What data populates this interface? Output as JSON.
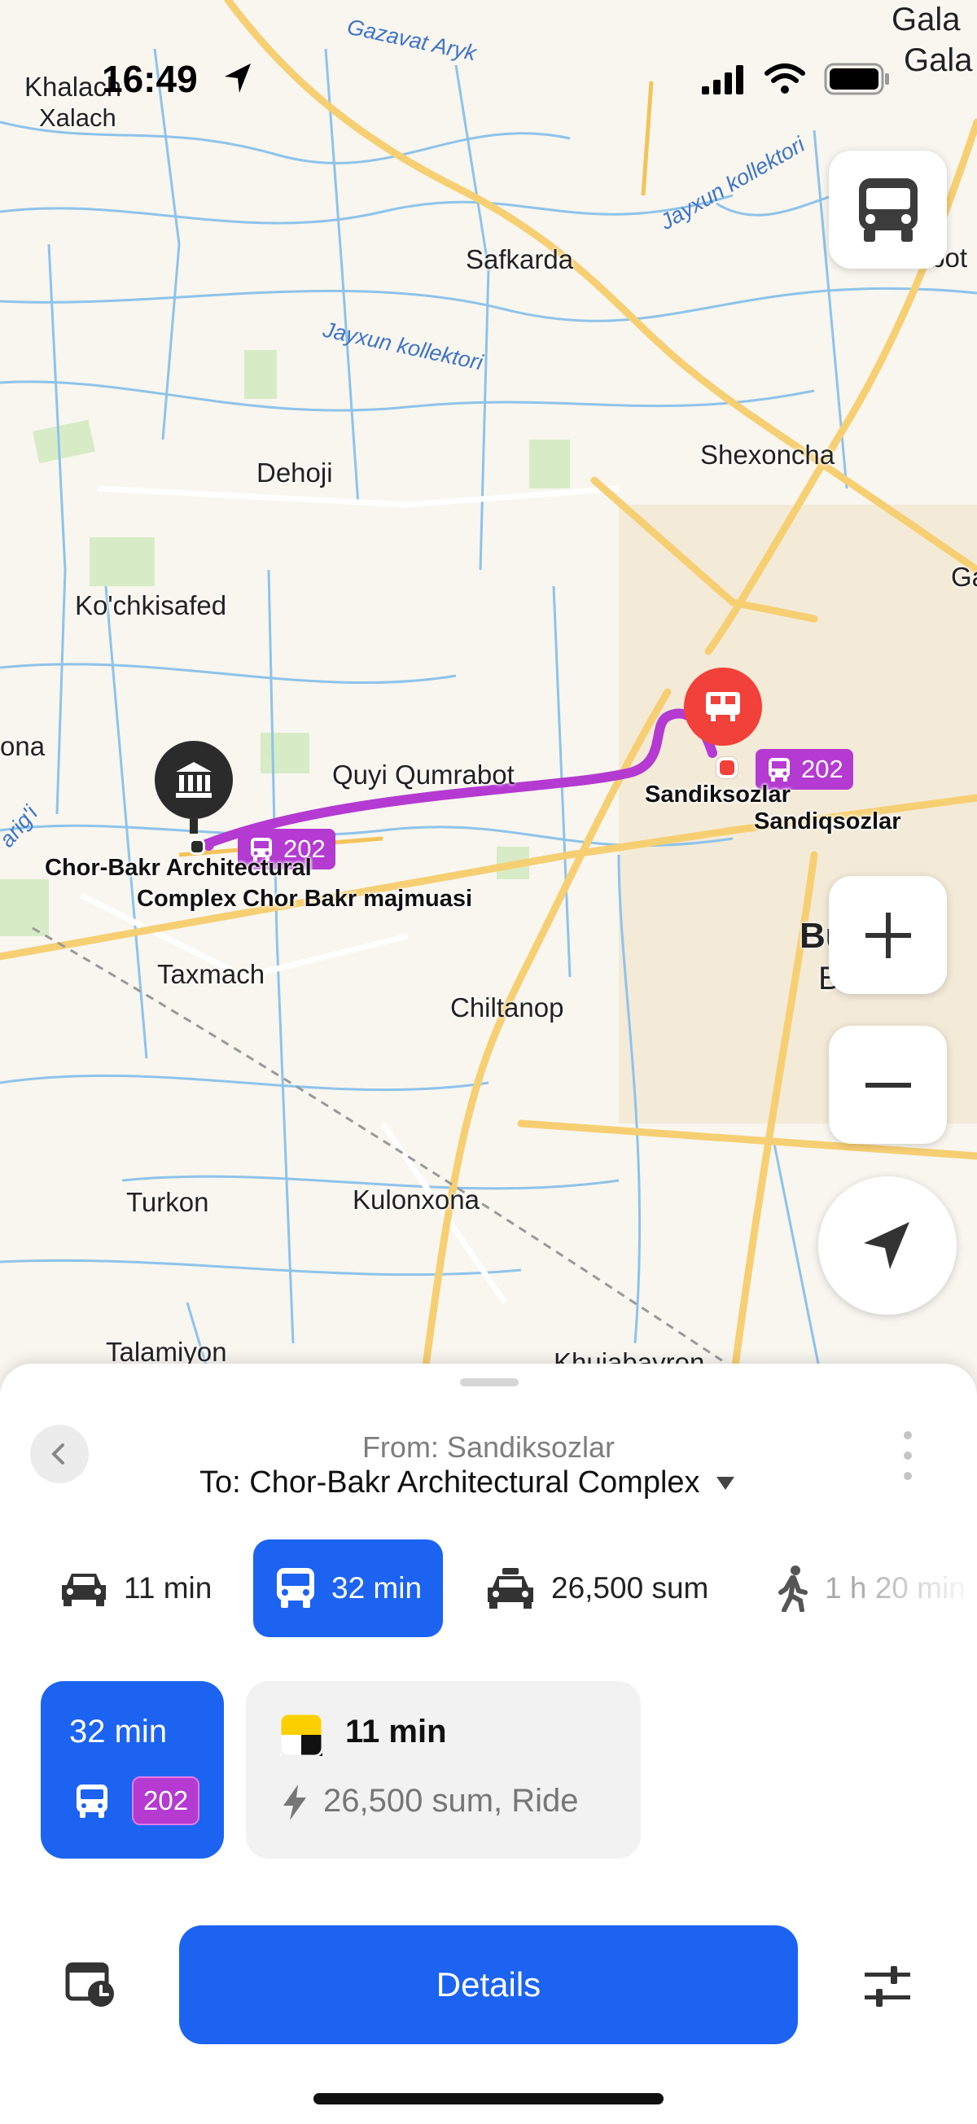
{
  "status_bar": {
    "time": "16:49"
  },
  "map": {
    "places": [
      {
        "id": "khalach",
        "text": "Khalach"
      },
      {
        "id": "xalach",
        "text": "Xalach"
      },
      {
        "id": "gala1",
        "text": "Gala"
      },
      {
        "id": "gala2",
        "text": "Gala"
      },
      {
        "id": "safkarda",
        "text": "Safkarda"
      },
      {
        "id": "rabot",
        "text": "Rabot"
      },
      {
        "id": "shexoncha",
        "text": "Shexoncha"
      },
      {
        "id": "dehoji",
        "text": "Dehoji"
      },
      {
        "id": "kochkisafed",
        "text": "Ko'chkisafed"
      },
      {
        "id": "quyi",
        "text": "Quyi Qumrabot"
      },
      {
        "id": "ona",
        "text": "ona"
      },
      {
        "id": "taxmach",
        "text": "Taxmach"
      },
      {
        "id": "chiltanop",
        "text": "Chiltanop"
      },
      {
        "id": "bukhara",
        "text": "Bukhara"
      },
      {
        "id": "buxoro",
        "text": "Buxoro"
      },
      {
        "id": "turkon",
        "text": "Turkon"
      },
      {
        "id": "kulonxona",
        "text": "Kulonxona"
      },
      {
        "id": "talamiyon",
        "text": "Talamiyon"
      },
      {
        "id": "khujabayron",
        "text": "Khujabayron"
      },
      {
        "id": "ga",
        "text": "Ga"
      }
    ],
    "waterways": [
      {
        "id": "gazavat",
        "text": "Gazavat Aryk"
      },
      {
        "id": "jayxun",
        "text": "Jayxun kollektori"
      },
      {
        "id": "jayxun2",
        "text": "Jayxun kollektori"
      },
      {
        "id": "arig",
        "text": "arig'i"
      }
    ],
    "pois": {
      "destination_1": "Chor-Bakr Architectural",
      "destination_2": "Complex",
      "destination_3": "Chor Bakr majmuasi",
      "origin_1": "Sandiksozlar",
      "origin_2": "Sandiqsozlar"
    },
    "route_number": "202",
    "route_color": "#b43ad1",
    "origin_color": "#f2403a"
  },
  "sheet": {
    "from": "From: Sandiksozlar",
    "to": "To: Chor-Bakr Architectural Complex",
    "modes": [
      {
        "id": "car",
        "icon": "car-icon",
        "label": "11 min"
      },
      {
        "id": "transit",
        "icon": "bus-icon",
        "label": "32 min",
        "active": true
      },
      {
        "id": "taxi",
        "icon": "taxi-icon",
        "label": "26,500 sum"
      },
      {
        "id": "walk",
        "icon": "walk-icon",
        "label": "1 h 20 min"
      }
    ],
    "option_transit": {
      "time": "32 min",
      "route": "202"
    },
    "option_taxi": {
      "time": "11 min",
      "detail": "26,500 sum, Ride"
    },
    "details_label": "Details"
  },
  "colors": {
    "accent": "#1c63f2",
    "route": "#b43ad1"
  }
}
